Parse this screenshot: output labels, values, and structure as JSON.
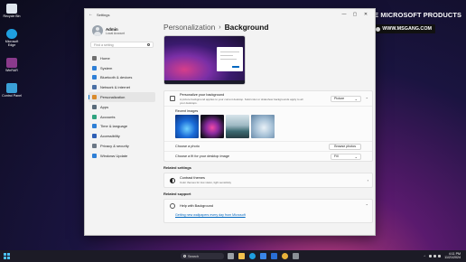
{
  "desktop": {
    "icons": [
      {
        "label": "Recycle Bin",
        "icon": "recycle-bin-icon",
        "color": "#dfe6ee"
      },
      {
        "label": "Microsoft Edge",
        "icon": "edge-icon",
        "color": "#1f9fe0"
      },
      {
        "label": "WinRAR",
        "icon": "winrar-icon",
        "color": "#8a3a8c"
      },
      {
        "label": "Control Panel",
        "icon": "control-panel-icon",
        "color": "#3aa0d8"
      }
    ]
  },
  "watermark": {
    "title": "FREE MICROSOFT PRODUCTS",
    "url": "WWW.MSGANG.COM"
  },
  "window": {
    "title": "Settings",
    "controls": {
      "minimize": "—",
      "maximize": "▢",
      "close": "✕"
    }
  },
  "sidebar": {
    "profile": {
      "name": "Admin",
      "account_type": "Local Account"
    },
    "search_placeholder": "Find a setting",
    "items": [
      {
        "label": "Home",
        "icon": "home-icon",
        "color": "#6f6f6f"
      },
      {
        "label": "System",
        "icon": "system-icon",
        "color": "#2e7fd6"
      },
      {
        "label": "Bluetooth & devices",
        "icon": "bluetooth-icon",
        "color": "#2e7fd6"
      },
      {
        "label": "Network & internet",
        "icon": "network-icon",
        "color": "#4a6fa5"
      },
      {
        "label": "Personalization",
        "icon": "personalization-icon",
        "color": "#d98a2b",
        "active": true
      },
      {
        "label": "Apps",
        "icon": "apps-icon",
        "color": "#5a6b7a"
      },
      {
        "label": "Accounts",
        "icon": "accounts-icon",
        "color": "#2fa37f"
      },
      {
        "label": "Time & language",
        "icon": "time-language-icon",
        "color": "#2e7fd6"
      },
      {
        "label": "Accessibility",
        "icon": "accessibility-icon",
        "color": "#2e5fb5"
      },
      {
        "label": "Privacy & security",
        "icon": "privacy-icon",
        "color": "#6b7785"
      },
      {
        "label": "Windows Update",
        "icon": "windows-update-icon",
        "color": "#2e7fd6"
      }
    ]
  },
  "main": {
    "breadcrumb": {
      "parent": "Personalization",
      "separator": "›",
      "current": "Background"
    },
    "personalize": {
      "title": "Personalize your background",
      "subtitle": "A picture background applies to your current desktop. Solid color or slideshow backgrounds apply to all your desktops.",
      "value": "Picture"
    },
    "recent_images_label": "Recent images",
    "recent_images": [
      {
        "name": "bloom-blue",
        "gradient": "radial-gradient(circle at 50% 60%, #6fd0ff 0%, #1a6bd8 45%, #0b2f7a 100%)"
      },
      {
        "name": "bloom-dark",
        "gradient": "radial-gradient(circle at 50% 55%, #f24aa6 0%, #8a2a9e 35%, #15101e 75%)"
      },
      {
        "name": "landscape-lake",
        "gradient": "linear-gradient(180deg, #d7e4ea 0%, #9fb9c4 45%, #3d6b73 70%, #263d44 100%)"
      },
      {
        "name": "glow-light",
        "gradient": "radial-gradient(circle at 55% 55%, #e9f1f7 0%, #a9c3d8 45%, #5b7fa0 100%)"
      }
    ],
    "choose_photo": {
      "label": "Choose a photo",
      "button": "Browse photos"
    },
    "choose_fit": {
      "label": "Choose a fit for your desktop image",
      "value": "Fill"
    },
    "related_settings_heading": "Related settings",
    "contrast_themes": {
      "title": "Contrast themes",
      "subtitle": "Color themes for low vision, light sensitivity"
    },
    "related_support_heading": "Related support",
    "help": {
      "title": "Help with Background",
      "link": "Getting new wallpapers every day from Microsoft"
    }
  },
  "taskbar": {
    "search_label": "Search",
    "apps": [
      {
        "icon": "task-view-icon",
        "color": "#9aa0a6"
      },
      {
        "icon": "file-explorer-icon",
        "color": "#f2c14e"
      },
      {
        "icon": "edge-icon",
        "color": "#1f9fe0"
      },
      {
        "icon": "store-icon",
        "color": "#3a86e8"
      },
      {
        "icon": "mail-icon",
        "color": "#2a6fd6"
      },
      {
        "icon": "chrome-icon",
        "color": "#e8b13a"
      },
      {
        "icon": "settings-icon",
        "color": "#8a8f96"
      }
    ],
    "tray_arrow": "^",
    "time": "4:11 PM",
    "date": "11/21/2024"
  }
}
